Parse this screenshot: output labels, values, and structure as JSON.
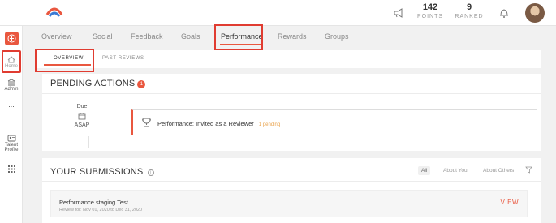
{
  "topbar": {
    "points": {
      "value": "142",
      "label": "POINTS"
    },
    "ranked": {
      "value": "9",
      "label": "RANKED"
    }
  },
  "sidebar": {
    "items": [
      {
        "label": "Home"
      },
      {
        "label": "Admin"
      },
      {
        "label": "..."
      },
      {
        "label": "Talent Profile"
      }
    ]
  },
  "tabs": [
    "Overview",
    "Social",
    "Feedback",
    "Goals",
    "Performance",
    "Rewards",
    "Groups"
  ],
  "active_tab": "Performance",
  "subtabs": [
    "OVERVIEW",
    "PAST REVIEWS"
  ],
  "pending": {
    "title": "PENDING ACTIONS",
    "count": "1",
    "due_label": "Due",
    "due_value": "ASAP",
    "action_text": "Performance: Invited as a Reviewer",
    "action_status": "1 pending"
  },
  "submissions": {
    "title": "YOUR SUBMISSIONS",
    "filters": [
      "All",
      "About You",
      "About Others"
    ],
    "item": {
      "title": "Performance staging Test",
      "subtitle": "Review for: Nov 01, 2020 to Dec 31, 2020",
      "action": "VIEW"
    }
  },
  "colors": {
    "accent": "#e9573f",
    "highlight": "#e03c31"
  },
  "icons": [
    "logo-icon",
    "megaphone-icon",
    "bell-icon",
    "plus-icon",
    "home-icon",
    "admin-icon",
    "more-icon",
    "talent-profile-icon",
    "grid-icon",
    "calendar-icon",
    "trophy-icon",
    "info-icon",
    "filter-icon"
  ]
}
